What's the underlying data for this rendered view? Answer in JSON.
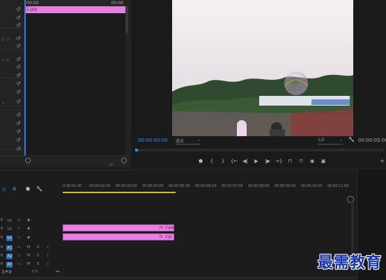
{
  "effect_controls": {
    "ruler_start": "00:00",
    "ruler_end": "00:00",
    "clip_name": "2.jpg"
  },
  "program_monitor": {
    "timecode_current": "00:00:00:00",
    "fit_label": "适合",
    "resolution_label": "1/2",
    "timecode_duration": "00:00:05:00",
    "playhead_progress": 0
  },
  "timeline": {
    "ruler_ticks": [
      "0:00:01:00",
      "00:00:02:00",
      "00:00:03:00",
      "00:00:04:00",
      "00:00:05:00",
      "00:00:06:00",
      "00:00:07:00",
      "00:00:08:00",
      "00:00:09:00",
      "00:00:10:00",
      "00:00:11:00"
    ],
    "video_tracks": [
      "V3",
      "V2",
      "V1"
    ],
    "audio_tracks": [
      "A1",
      "A2",
      "A3"
    ],
    "track_letters": {
      "mute": "M",
      "solo": "S"
    },
    "master_label": "主声道",
    "master_value": "0.0",
    "clip_v2": "2.jpg",
    "clip_v1": "2.jp"
  },
  "watermark": "最需教育",
  "colors": {
    "accent": "#2e8fff",
    "clip": "#e87ee0",
    "work_area": "#d9c300",
    "track_on": "#2d6fae"
  }
}
